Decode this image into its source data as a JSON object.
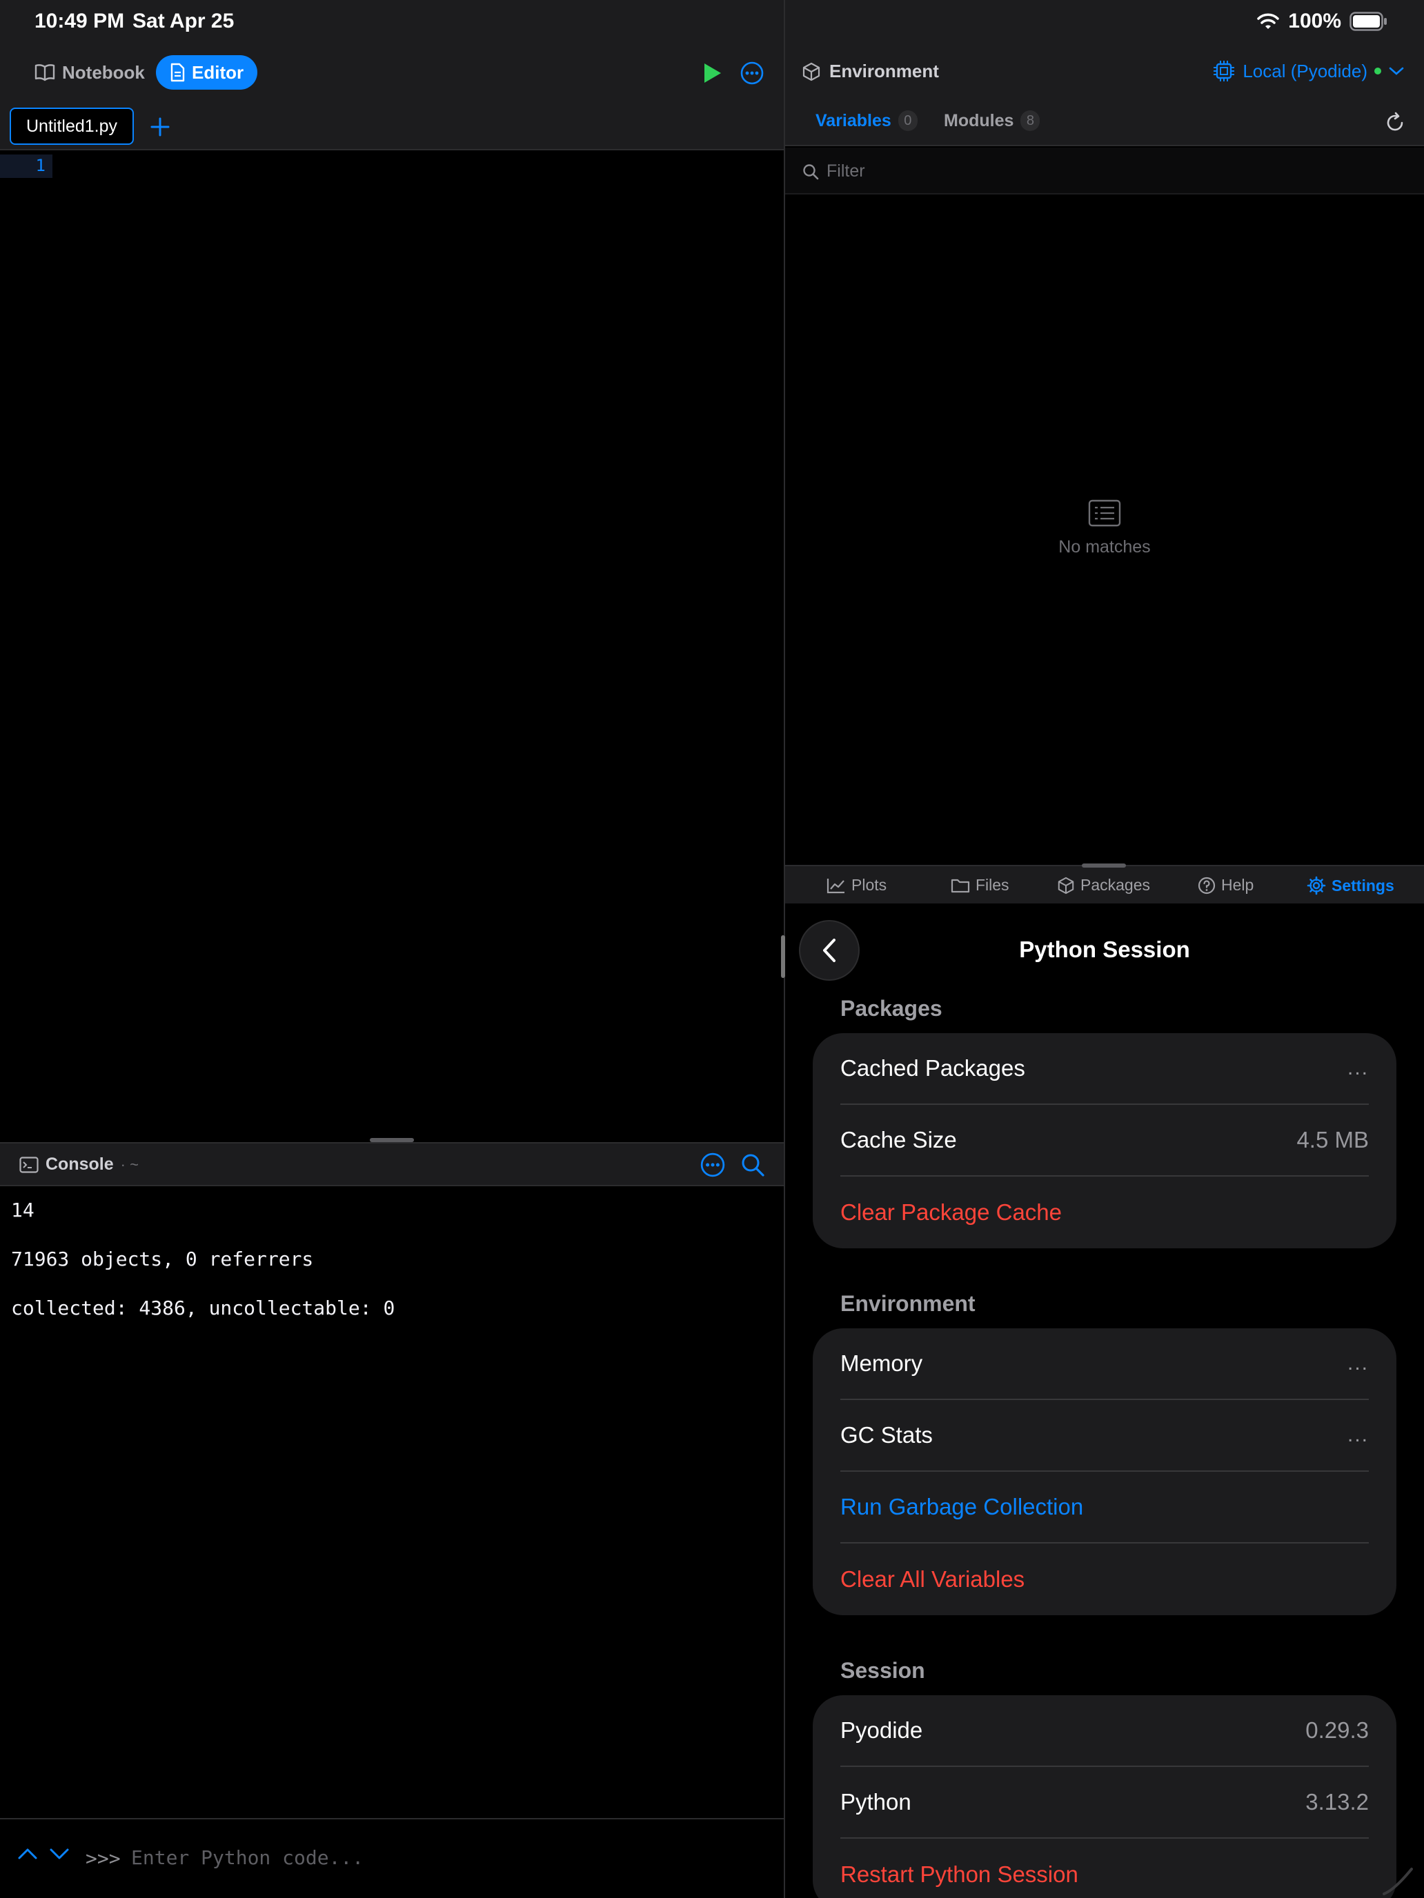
{
  "status_bar": {
    "time": "10:49 PM",
    "date": "Sat Apr 25",
    "battery": "100%"
  },
  "left": {
    "modes": {
      "notebook": "Notebook",
      "editor": "Editor"
    },
    "file_tab": "Untitled1.py",
    "editor": {
      "line_numbers": [
        "1"
      ]
    },
    "console": {
      "title": "Console",
      "subtitle": "· ~",
      "lines": [
        "14",
        "71963 objects, 0 referrers",
        "collected: 4386, uncollectable: 0"
      ],
      "prompt": ">>>",
      "placeholder": "Enter Python code..."
    }
  },
  "right": {
    "env_title": "Environment",
    "runtime": "Local (Pyodide)",
    "tabs": {
      "variables": "Variables",
      "variables_count": "0",
      "modules": "Modules",
      "modules_count": "8"
    },
    "filter_placeholder": "Filter",
    "empty_text": "No matches",
    "bottom_tabs": {
      "plots": "Plots",
      "files": "Files",
      "packages": "Packages",
      "help": "Help",
      "settings": "Settings"
    },
    "settings": {
      "title": "Python Session",
      "packages_label": "Packages",
      "cached_packages": "Cached Packages",
      "ellipsis": "...",
      "cache_size": "Cache Size",
      "cache_size_value": "4.5 MB",
      "clear_cache": "Clear Package Cache",
      "environment_label": "Environment",
      "memory": "Memory",
      "gc_stats": "GC Stats",
      "run_gc": "Run Garbage Collection",
      "clear_vars": "Clear All Variables",
      "session_label": "Session",
      "pyodide": "Pyodide",
      "pyodide_version": "0.29.3",
      "python": "Python",
      "python_version": "3.13.2",
      "restart": "Restart Python Session"
    }
  },
  "colors": {
    "accent": "#0a84ff",
    "destructive": "#ff453a",
    "run": "#30d158",
    "panel": "#1c1c1e"
  }
}
